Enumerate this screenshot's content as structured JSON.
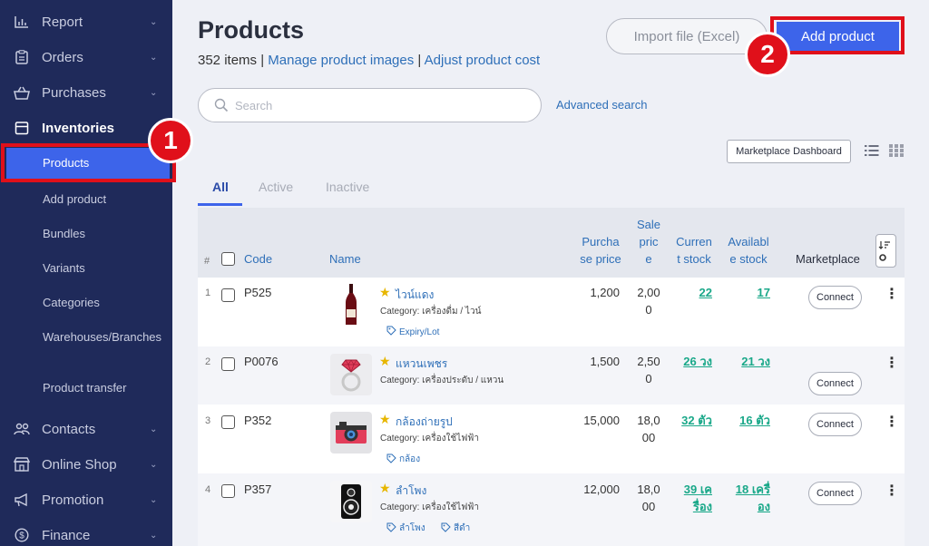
{
  "sidebar": {
    "items": [
      {
        "label": "Report",
        "icon": "chart-icon"
      },
      {
        "label": "Orders",
        "icon": "clipboard-icon"
      },
      {
        "label": "Purchases",
        "icon": "basket-icon"
      },
      {
        "label": "Inventories",
        "icon": "box-icon"
      },
      {
        "label": "Contacts",
        "icon": "people-icon"
      },
      {
        "label": "Online Shop",
        "icon": "shop-icon"
      },
      {
        "label": "Promotion",
        "icon": "megaphone-icon"
      },
      {
        "label": "Finance",
        "icon": "dollar-icon"
      }
    ],
    "sub_items": [
      "Products",
      "Add product",
      "Bundles",
      "Variants",
      "Categories",
      "Warehouses/Branches",
      "Product transfer"
    ]
  },
  "annotations": {
    "badge1": "1",
    "badge2": "2"
  },
  "header": {
    "title": "Products",
    "count": "352 items",
    "sep": "|",
    "link_images": "Manage product images",
    "link_cost": "Adjust product cost",
    "import_label": "Import file (Excel)",
    "add_label": "Add product"
  },
  "search": {
    "placeholder": "Search",
    "advanced": "Advanced search"
  },
  "toolbar": {
    "marketplace_dashboard": "Marketplace Dashboard"
  },
  "tabs": [
    "All",
    "Active",
    "Inactive"
  ],
  "table": {
    "headers": {
      "num": "#",
      "code": "Code",
      "name": "Name",
      "purchase": [
        "Purcha",
        "se price"
      ],
      "sale": [
        "Sale",
        "pric",
        "e"
      ],
      "current": [
        "Curren",
        "t stock"
      ],
      "available": [
        "Availabl",
        "e stock"
      ],
      "marketplace": "Marketplace"
    },
    "connect_label": "Connect",
    "rows": [
      {
        "num": "1",
        "code": "P525",
        "name": "ไวน์แดง",
        "category": "Category: เครื่องดื่ม / ไวน์",
        "tags": [
          "Expiry/Lot"
        ],
        "purchase": "1,200",
        "sale": [
          "2,00",
          "0"
        ],
        "current": [
          "22"
        ],
        "available": [
          "17"
        ],
        "thumb": "wine-bottle-image"
      },
      {
        "num": "2",
        "code": "P0076",
        "name": "แหวนเพชร",
        "category": "Category: เครื่องประดับ / แหวน",
        "tags": [],
        "purchase": "1,500",
        "sale": [
          "2,50",
          "0"
        ],
        "current": [
          "26 วง"
        ],
        "available": [
          "21 วง"
        ],
        "thumb": "ring-image"
      },
      {
        "num": "3",
        "code": "P352",
        "name": "กล้องถ่ายรูป",
        "category": "Category: เครื่องใช้ไฟฟ้า",
        "tags": [
          "กล้อง"
        ],
        "purchase": "15,000",
        "sale": [
          "18,0",
          "00"
        ],
        "current": [
          "32 ตัว"
        ],
        "available": [
          "16 ตัว"
        ],
        "thumb": "camera-image"
      },
      {
        "num": "4",
        "code": "P357",
        "name": "ลำโพง",
        "category": "Category: เครื่องใช้ไฟฟ้า",
        "tags": [
          "ลำโพง",
          "สีดำ"
        ],
        "purchase": "12,000",
        "sale": [
          "18,0",
          "00"
        ],
        "current": [
          "39 เค",
          "รื่อง"
        ],
        "available": [
          "18 เครื่",
          "อง"
        ],
        "thumb": "speaker-image"
      }
    ]
  },
  "colors": {
    "sidebar": "#1f2a5a",
    "accent": "#3d64ea",
    "highlight": "#e0101a",
    "stock": "#1aa889",
    "link": "#2e6fb8"
  }
}
